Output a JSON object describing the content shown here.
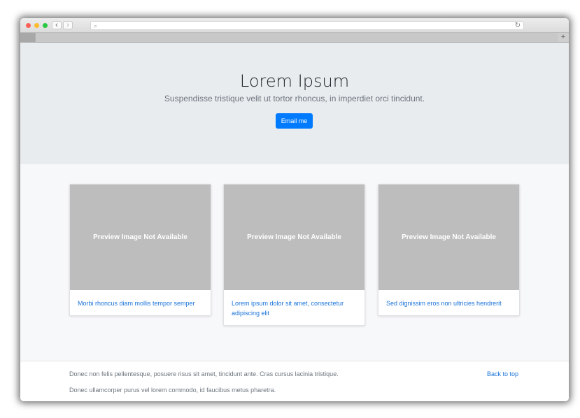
{
  "browser": {
    "search_icon": "⌕",
    "reload_icon": "↻",
    "back_icon": "‹",
    "forward_icon": "›",
    "new_tab_icon": "+"
  },
  "hero": {
    "title": "Lorem Ipsum",
    "subtitle": "Suspendisse tristique velit ut tortor rhoncus, in imperdiet orci tincidunt.",
    "button_label": "Email me"
  },
  "cards": [
    {
      "image_text": "Preview Image Not Available",
      "link": "Morbi rhoncus diam mollis tempor semper"
    },
    {
      "image_text": "Preview Image Not Available",
      "link": "Lorem ipsum dolor sit amet, consectetur adipiscing elit"
    },
    {
      "image_text": "Preview Image Not Available",
      "link": "Sed dignissim eros non ultricies hendrerit"
    }
  ],
  "footer": {
    "line1": "Donec non felis pellentesque, posuere risus sit amet, tincidunt ante. Cras cursus lacinia tristique.",
    "line2": "Donec ullamcorper purus vel lorem commodo, id faucibus metus pharetra.",
    "back_to_top": "Back to top"
  },
  "colors": {
    "accent": "#007bff",
    "link": "#1a73d9",
    "hero_bg": "#e9ecef",
    "placeholder_bg": "#bdbdbd"
  }
}
